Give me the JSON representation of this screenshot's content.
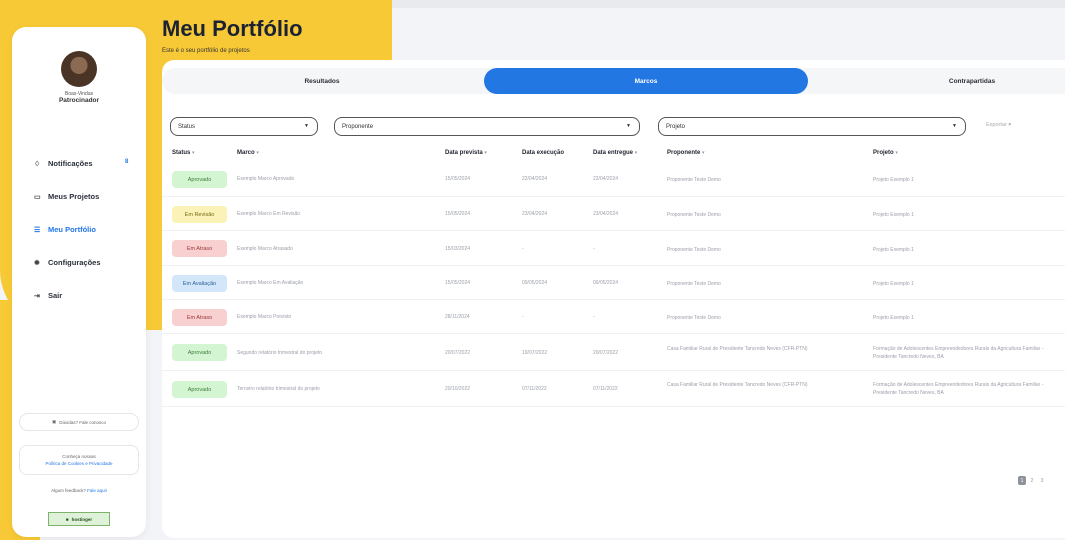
{
  "sidebar": {
    "user_name": "Boas-Vindas",
    "user_role": "Patrocinador",
    "items": [
      {
        "label": "Notificações",
        "icon": "bell-icon",
        "badge": "8"
      },
      {
        "label": "Meus Projetos",
        "icon": "folder-icon"
      },
      {
        "label": "Meu Portfólio",
        "icon": "portfolio-icon",
        "active": true
      },
      {
        "label": "Configurações",
        "icon": "gear-icon"
      },
      {
        "label": "Sair",
        "icon": "logout-icon"
      }
    ],
    "support_text": "Dúvidas? Fale conosco",
    "policy_text": "Conheça nossas",
    "policy_link": "Política de Cookies e Privacidade",
    "feedback_text": "Algum feedback?",
    "feedback_link": "Fale aqui!",
    "host_logo": "hostinger"
  },
  "header": {
    "title": "Meu Portfólio",
    "subtitle": "Este é o seu portfólio de projetos"
  },
  "tabs": [
    {
      "label": "Resultados"
    },
    {
      "label": "Marcos",
      "active": true
    },
    {
      "label": "Contrapartidas"
    }
  ],
  "filters": {
    "status": "Status",
    "proponente": "Proponente",
    "projeto": "Projeto",
    "export": "Exportar"
  },
  "columns": [
    "Status",
    "Marco",
    "Data prevista",
    "Data execução",
    "Data entregue",
    "Proponente",
    "Projeto"
  ],
  "rows": [
    {
      "status": "Aprovado",
      "color": "green",
      "marco": "Exemplo Marco Aprovado",
      "prevista": "15/05/2024",
      "execucao": "22/04/2024",
      "entregue": "22/04/2024",
      "proponente": "Proponente Teste Demo",
      "projeto": "Projeto Exemplo 1"
    },
    {
      "status": "Em Revisão",
      "color": "yellow",
      "marco": "Exemplo Marco Em Revisão",
      "prevista": "15/05/2024",
      "execucao": "23/04/2024",
      "entregue": "23/04/2024",
      "proponente": "Proponente Teste Demo",
      "projeto": "Projeto Exemplo 1"
    },
    {
      "status": "Em Atraso",
      "color": "red",
      "marco": "Exemplo Marco Atrasado",
      "prevista": "15/03/2024",
      "execucao": "-",
      "entregue": "-",
      "proponente": "Proponente Teste Demo",
      "projeto": "Projeto Exemplo 1"
    },
    {
      "status": "Em Avaliação",
      "color": "blue",
      "marco": "Exemplo Marco Em Avaliação",
      "prevista": "15/05/2024",
      "execucao": "09/05/2024",
      "entregue": "09/05/2024",
      "proponente": "Proponente Teste Demo",
      "projeto": "Projeto Exemplo 1"
    },
    {
      "status": "Em Atraso",
      "color": "red",
      "marco": "Exemplo Marco Previsto",
      "prevista": "28/11/2024",
      "execucao": "-",
      "entregue": "-",
      "proponente": "Proponente Teste Demo",
      "projeto": "Projeto Exemplo 1"
    },
    {
      "status": "Aprovado",
      "color": "green",
      "marco": "Segundo relatório trimestral do projeto",
      "prevista": "20/07/2022",
      "execucao": "19/07/2022",
      "entregue": "20/07/2022",
      "proponente": "Casa Familiar Rural de Presidente Tancredo Neves (CFR-PTN)",
      "projeto": "Formação de Adolescentes Empreendedores Rurais da Agricultura Familiar - Presidente Tancredo Neves, BA"
    },
    {
      "status": "Aprovado",
      "color": "green",
      "marco": "Terceiro relatório trimestral do projeto",
      "prevista": "20/10/2022",
      "execucao": "07/11/2022",
      "entregue": "07/11/2022",
      "proponente": "Casa Familiar Rural de Presidente Tancredo Neves (CFR-PTN)",
      "projeto": "Formação de Adolescentes Empreendedores Rurais da Agricultura Familiar - Presidente Tancredo Neves, BA"
    }
  ],
  "pagination": {
    "pages": [
      "1",
      "2",
      "3"
    ],
    "current": "1"
  },
  "colors": {
    "accent": "#2377e3",
    "yellow_bg": "#f8c936"
  }
}
